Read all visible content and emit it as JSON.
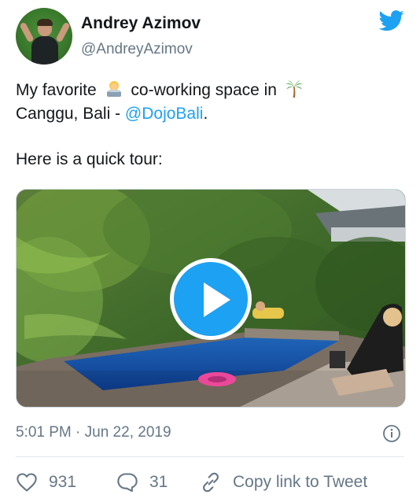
{
  "author": {
    "name": "Andrey Azimov",
    "handle": "@AndreyAzimov"
  },
  "tweet": {
    "line1_pre": "My favorite",
    "line1_post": "co-working space in",
    "line2_pre": "Canggu, Bali - ",
    "mention": "@DojoBali",
    "line2_post": ".",
    "line3": "Here is a quick tour:",
    "emojis": [
      "woman-technologist-emoji",
      "palm-tree-emoji"
    ]
  },
  "media": {
    "type": "video",
    "play_icon": "play-icon"
  },
  "timestamp": "5:01 PM · Jun 22, 2019",
  "actions": {
    "likes": "931",
    "replies": "31",
    "copy_link": "Copy link to Tweet"
  },
  "colors": {
    "accent": "#1da1f2",
    "text": "#14171a",
    "secondary": "#657786",
    "border": "#e1e8ed"
  }
}
